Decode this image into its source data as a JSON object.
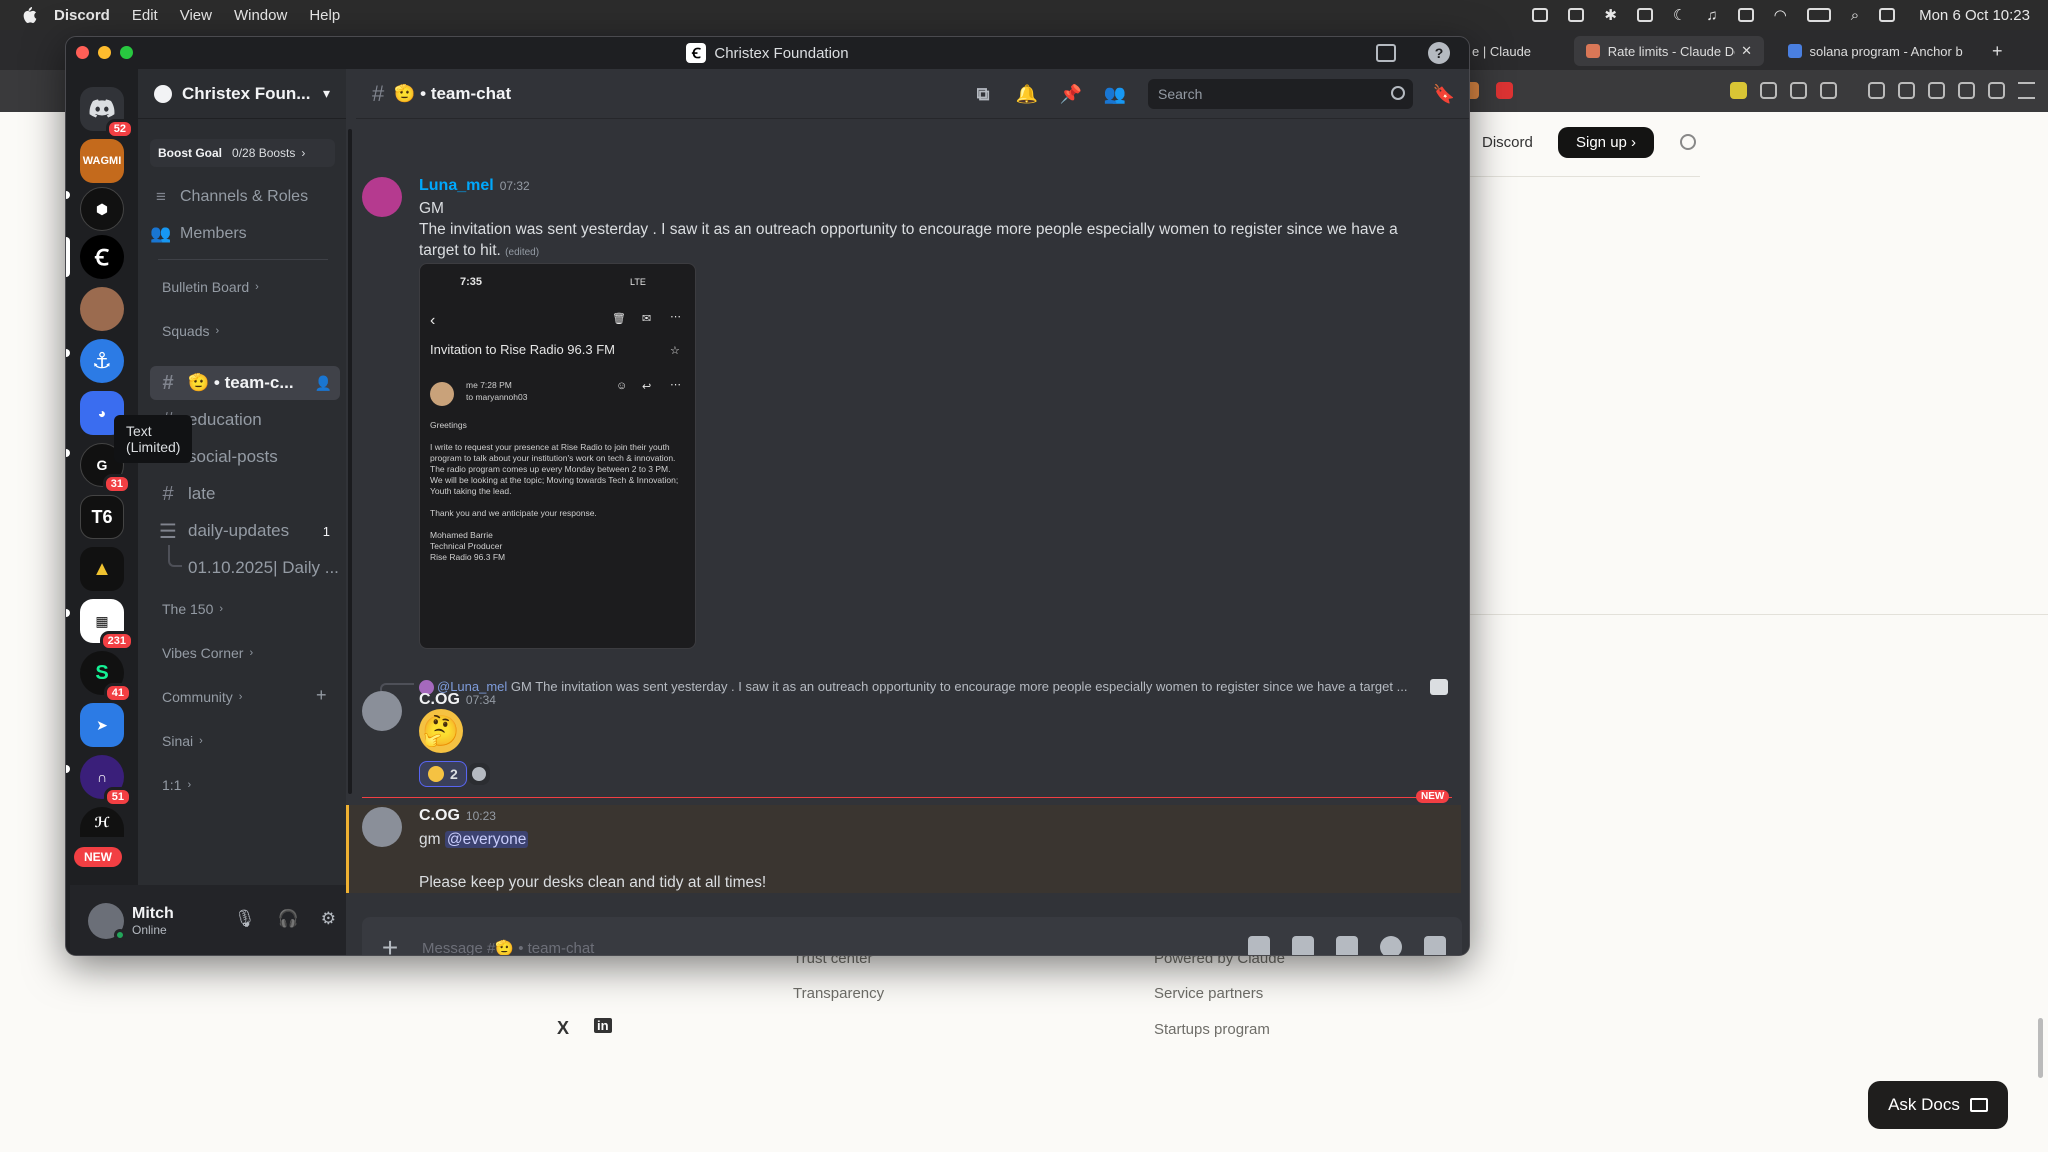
{
  "menubar": {
    "app": "Discord",
    "menus": [
      "Edit",
      "View",
      "Window",
      "Help"
    ],
    "clock": "Mon 6 Oct  10:23"
  },
  "browser": {
    "tabs": [
      "e | Claude",
      "Rate limits - Claude Do",
      "solana program - Anchor b"
    ],
    "nav": {
      "discord": "Discord",
      "signup": "Sign up"
    },
    "footer": {
      "col1": [
        "Trust center",
        "Transparency"
      ],
      "col2": [
        "Powered by Claude",
        "Service partners",
        "Startups program"
      ]
    },
    "social": [
      "X",
      "in"
    ],
    "ask_docs": "Ask Docs"
  },
  "window": {
    "title": "Christex Foundation"
  },
  "rail": {
    "home_badge": "52",
    "server_names": [
      "WAGMI",
      "T6"
    ],
    "badges": [
      "31",
      "231",
      "41",
      "51"
    ],
    "new_label": "NEW",
    "tooltip": "Text (Limited)"
  },
  "server": {
    "name": "Christex Foun...",
    "boost_goal": "Boost Goal",
    "boosts": "0/28 Boosts",
    "nav": [
      {
        "label": "Channels & Roles"
      },
      {
        "label": "Members"
      }
    ],
    "categories": [
      "Bulletin Board",
      "Squads",
      "The 150",
      "Vibes Corner",
      "Community",
      "Sinai",
      "1:1"
    ],
    "channels": [
      {
        "name": "🫡 • team-c..."
      },
      {
        "name": "education"
      },
      {
        "name": "social-posts"
      },
      {
        "name": "late"
      },
      {
        "name": "daily-updates",
        "count": "1"
      }
    ],
    "thread": "01.10.2025| Daily ..."
  },
  "user": {
    "name": "Mitch",
    "status": "Online"
  },
  "chat": {
    "channel": "🫡 • team-chat",
    "search_placeholder": "Search",
    "messages": [
      {
        "author": "Luna_mel",
        "time": "07:32",
        "line1": "GM",
        "line2": "The invitation was sent yesterday . I saw it as an outreach opportunity to encourage more people especially women to register since we have a target to hit.",
        "edited": "(edited)"
      },
      {
        "reply_author": "@Luna_mel",
        "reply_text": "GM The invitation was sent yesterday . I saw it as an outreach opportunity to encourage more people especially women to register since we have a target ...",
        "author": "C.OG",
        "time": "07:34",
        "reaction_count": "2"
      },
      {
        "author": "C.OG",
        "time": "10:23",
        "line1_prefix": "gm",
        "mention": "@everyone",
        "line2": "Please keep your desks clean and tidy at all times!"
      }
    ],
    "new_tag": "NEW",
    "composer_placeholder": "Message #🫡 • team-chat"
  },
  "screenshot": {
    "time": "7:35",
    "signal": "LTE",
    "subject": "Invitation to Rise Radio 96.3 FM",
    "sender": "me",
    "sender_time": "7:28 PM",
    "to": "to maryannoh03",
    "greeting": "Greetings",
    "body1": "I write to request your presence at Rise Radio to join their youth program to talk about your institution's work on tech & innovation.",
    "body2": "The radio program comes up every Monday between 2 to 3 PM. We will be looking at the topic; Moving towards Tech & Innovation; Youth taking the lead.",
    "thanks": "Thank you and we anticipate your response.",
    "sign1": "Mohamed Barrie",
    "sign2": "Technical Producer",
    "sign3": "Rise Radio 96.3 FM"
  },
  "colors": {
    "accent": "#5865f2",
    "danger": "#f23f43",
    "link": "#00a8fc",
    "online": "#23a55a"
  }
}
